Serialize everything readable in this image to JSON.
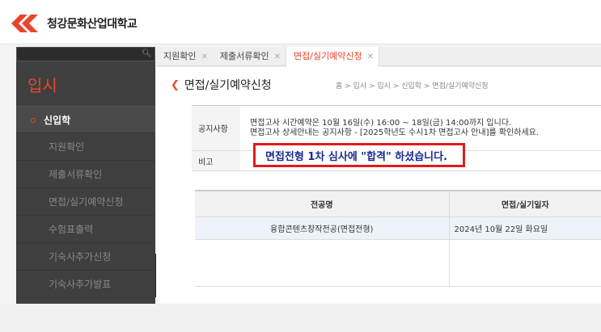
{
  "header": {
    "logo_text": "청강문화산업대학교",
    "brand_color": "#e8452a"
  },
  "sidebar": {
    "search": {
      "value": "",
      "placeholder": ""
    },
    "title": "입시",
    "category": "신입학",
    "items": [
      {
        "label": "지원확인"
      },
      {
        "label": "제출서류확인"
      },
      {
        "label": "면접/실기예약신청"
      },
      {
        "label": "수험표출력"
      },
      {
        "label": "기숙사추가신청"
      },
      {
        "label": "기숙사추가발표"
      }
    ]
  },
  "tabs": [
    {
      "label": "지원확인",
      "active": false
    },
    {
      "label": "제출서류확인",
      "active": false
    },
    {
      "label": "면접/실기예약신청",
      "active": true
    }
  ],
  "main": {
    "title": "면접/실기예약신청",
    "breadcrumb": "홈 > 입시 > 입시 > 신입학 > 면접/실기예약신청",
    "notice_label": "공지사항",
    "notice_line1": "면접고사 시간예약은 10월 16일(수) 16:00 ~ 18일(금) 14:00까지 입니다.",
    "notice_line2": "면접고사 상세안내는 공지사항 - [2025학년도 수시1차 면접고사 안내]를 확인하세요.",
    "note_label": "비고",
    "note_text": "면접전형 1차 심사에 \"합격\" 하셨습니다.",
    "table": {
      "headers": [
        "전공명",
        "면접/실기일자"
      ],
      "rows": [
        [
          "융합콘텐츠창작전공(면접전형)",
          "2024년 10월 22일 화요일"
        ]
      ]
    }
  }
}
